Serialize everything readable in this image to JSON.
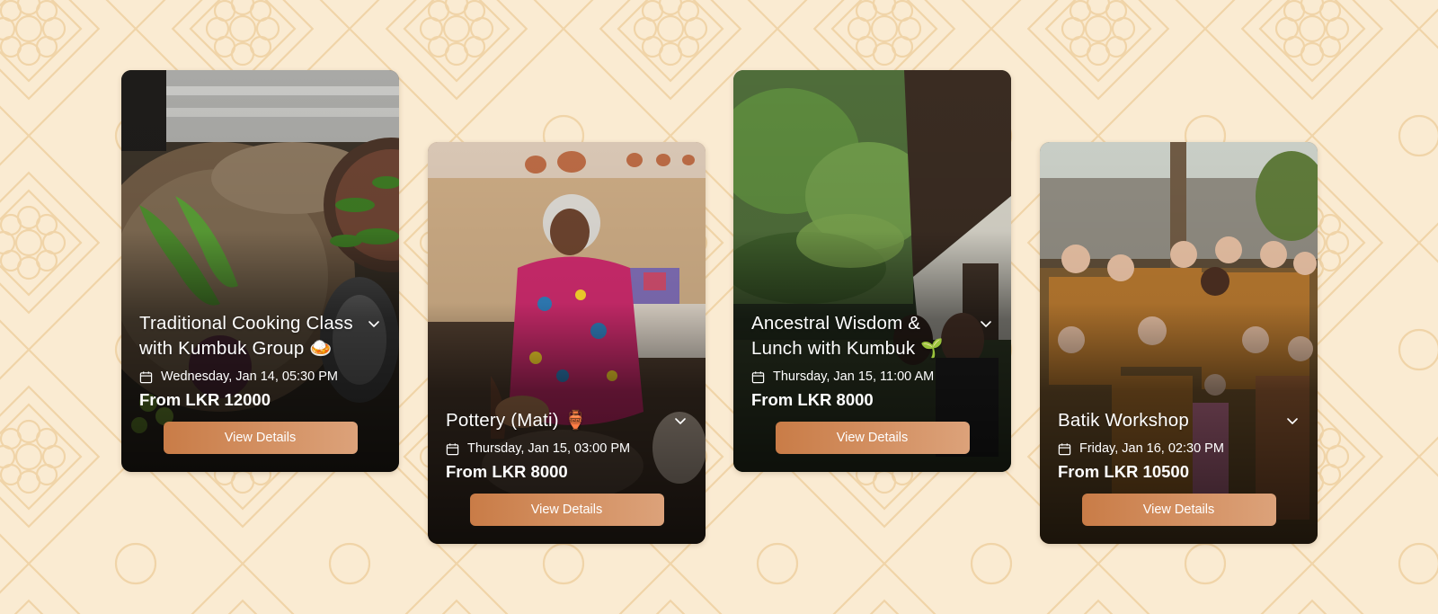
{
  "cards": [
    {
      "title": "Traditional Cooking Class with Kumbuk Group 🍛",
      "date": "Wednesday, Jan 14, 05:30 PM",
      "price": "From LKR 12000",
      "button": "View Details",
      "image": "kitchen ingredients: green beans, curry leaves in clay pot, woven basket"
    },
    {
      "title": "Pottery (Mati) 🏺",
      "date": "Thursday, Jan 15, 03:00 PM",
      "price": "From LKR 8000",
      "button": "View Details",
      "image": "elderly woman shaping clay on potter's wheel"
    },
    {
      "title": "Ancestral Wisdom & Lunch with Kumbuk 🌱",
      "date": "Thursday, Jan 15, 11:00 AM",
      "price": "From LKR 8000",
      "button": "View Details",
      "image": "leafy garden path beside a house"
    },
    {
      "title": "Batik Workshop",
      "date": "Friday, Jan 16, 02:30 PM",
      "price": "From LKR 10500",
      "button": "View Details",
      "image": "group of people holding batik fabrics outdoors"
    }
  ]
}
